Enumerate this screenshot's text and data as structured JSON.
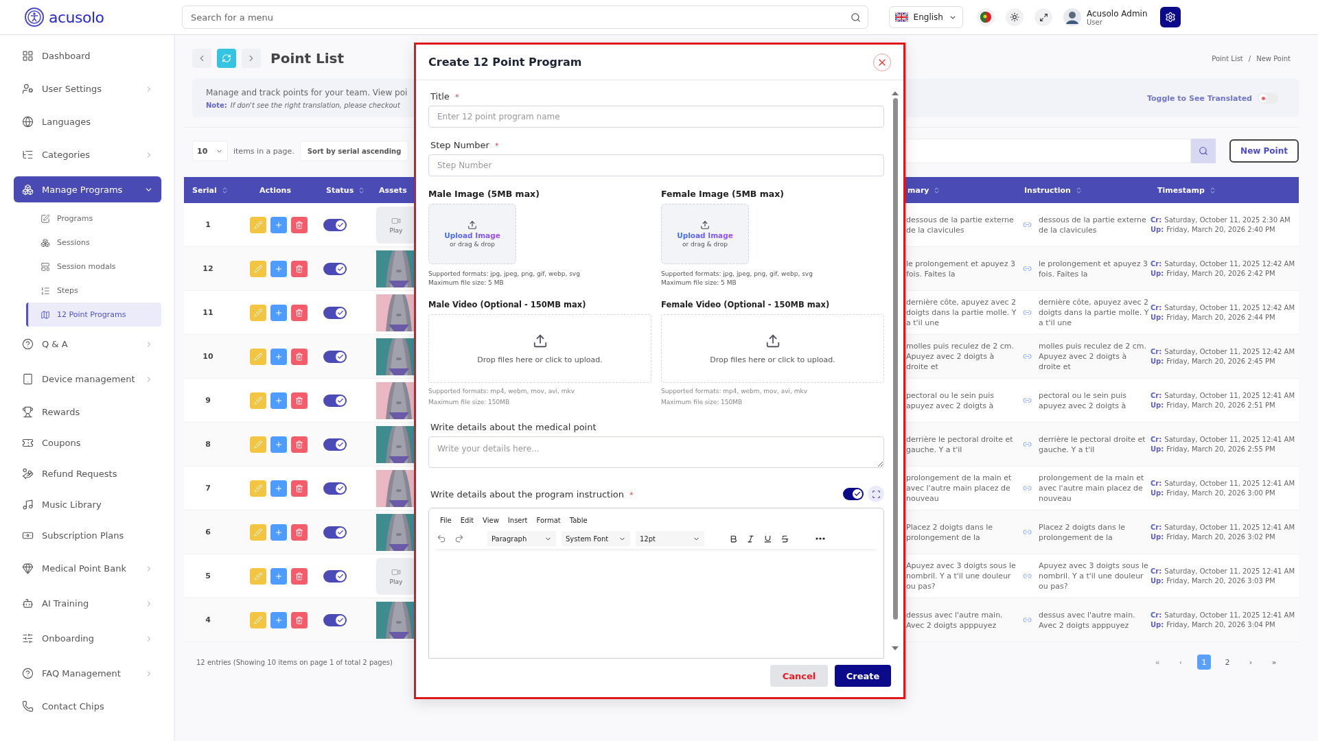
{
  "header": {
    "logo": "acusolo",
    "search_placeholder": "Search for a menu",
    "language": "English",
    "user": {
      "name": "Acusolo Admin",
      "role": "User"
    }
  },
  "sidebar": {
    "items": [
      {
        "label": "Dashboard",
        "selected": false
      },
      {
        "label": "User Settings",
        "selected": false,
        "expanded": false
      },
      {
        "label": "Languages",
        "selected": false
      },
      {
        "label": "Categories",
        "selected": false,
        "expanded": false
      },
      {
        "label": "Manage Programs",
        "selected": true,
        "expanded": true,
        "children": [
          {
            "label": "Programs",
            "selected": false
          },
          {
            "label": "Sessions",
            "selected": false
          },
          {
            "label": "Session modals",
            "selected": false
          },
          {
            "label": "Steps",
            "selected": false
          },
          {
            "label": "12 Point Programs",
            "selected": true
          }
        ]
      },
      {
        "label": "Q & A",
        "selected": false,
        "expanded": false
      },
      {
        "label": "Device management",
        "selected": false,
        "expanded": false
      },
      {
        "label": "Rewards",
        "selected": false
      },
      {
        "label": "Coupons",
        "selected": false
      },
      {
        "label": "Refund Requests",
        "selected": false
      },
      {
        "label": "Music Library",
        "selected": false
      },
      {
        "label": "Subscription Plans",
        "selected": false
      },
      {
        "label": "Medical Point Bank",
        "selected": false,
        "expanded": false
      },
      {
        "label": "AI Training",
        "selected": false,
        "expanded": false
      },
      {
        "label": "Onboarding",
        "selected": false,
        "expanded": false
      },
      {
        "label": "FAQ Management",
        "selected": false,
        "expanded": false
      },
      {
        "label": "Contact Chips",
        "selected": false
      }
    ]
  },
  "page": {
    "title": "Point List",
    "breadcrumb": {
      "items": [
        "Point List",
        "New Point"
      ],
      "separator": "/"
    },
    "description": "Manage and track points for your team. View poi",
    "note_label": "Note:",
    "note": "If don't see the right translation, please checkout",
    "translate_toggle": {
      "label": "Toggle to See Translated",
      "on": false
    },
    "page_size": "10",
    "page_size_label": "items in a page.",
    "sort": "Sort by serial ascending",
    "new_button": "New Point"
  },
  "table": {
    "columns": [
      {
        "label": "Serial",
        "sortable": true
      },
      {
        "label": "Actions",
        "sortable": false
      },
      {
        "label": "Status",
        "sortable": true
      },
      {
        "label": "Assets",
        "sortable": false
      },
      {
        "label": "mary",
        "sortable": true
      },
      {
        "label": "Instruction",
        "sortable": true
      },
      {
        "label": "Timestamp",
        "sortable": true
      }
    ],
    "rows": [
      {
        "serial": "1",
        "on": true,
        "assets": [
          {
            "kind": "video",
            "label": "Play"
          }
        ],
        "summary": "dessous de la partie externe de la clavicules",
        "instruction": "dessous de la partie externe de la clavicules",
        "cr_label": "Cr:",
        "created": "Saturday, October 11, 2025 2:30 AM",
        "up_label": "Up:",
        "updated": "Friday, March 20, 2026 2:40 PM"
      },
      {
        "serial": "12",
        "on": true,
        "summary": "le prolongement et apuyez 3 fois. Faites la",
        "instruction": "le prolongement et apuyez 3 fois. Faites la",
        "cr_label": "Cr:",
        "created": "Saturday, October 11, 2025 12:42 AM",
        "up_label": "Up:",
        "updated": "Friday, March 20, 2026 2:42 PM"
      },
      {
        "serial": "11",
        "on": true,
        "summary": "dernière côte, apuyez avec 2 doigts dans la partie molle. Y a t'il une",
        "instruction": "dernière côte, apuyez avec 2 doigts dans la partie molle. Y a t'il une",
        "cr_label": "Cr:",
        "created": "Saturday, October 11, 2025 12:42 AM",
        "up_label": "Up:",
        "updated": "Friday, March 20, 2026 2:44 PM"
      },
      {
        "serial": "10",
        "on": true,
        "summary": "molles puis reculez de 2 cm. Apuyez avec 2 doigts à droite et",
        "instruction": "molles puis reculez de 2 cm. Apuyez avec 2 doigts à droite et",
        "cr_label": "Cr:",
        "created": "Saturday, October 11, 2025 12:42 AM",
        "up_label": "Up:",
        "updated": "Friday, March 20, 2026 2:45 PM"
      },
      {
        "serial": "9",
        "on": true,
        "summary": "pectoral ou le sein puis apuyez avec 2 doigts à",
        "instruction": "pectoral ou le sein puis apuyez avec 2 doigts à",
        "cr_label": "Cr:",
        "created": "Saturday, October 11, 2025 12:41 AM",
        "up_label": "Up:",
        "updated": "Friday, March 20, 2026 2:51 PM"
      },
      {
        "serial": "8",
        "on": true,
        "summary": "derrière le pectoral droite et gauche. Y a t'il",
        "instruction": "derrière le pectoral droite et gauche. Y a t'il",
        "cr_label": "Cr:",
        "created": "Saturday, October 11, 2025 12:41 AM",
        "up_label": "Up:",
        "updated": "Friday, March 20, 2026 2:55 PM"
      },
      {
        "serial": "7",
        "on": true,
        "summary": "prolongement de la main et avec l'autre main placez de nouveau",
        "instruction": "prolongement de la main et avec l'autre main placez de nouveau",
        "cr_label": "Cr:",
        "created": "Saturday, October 11, 2025 12:41 AM",
        "up_label": "Up:",
        "updated": "Friday, March 20, 2026 3:00 PM"
      },
      {
        "serial": "6",
        "on": true,
        "summary": "Placez 2 doigts dans le prolongement de la",
        "instruction": "Placez 2 doigts dans le prolongement de la",
        "cr_label": "Cr:",
        "created": "Saturday, October 11, 2025 12:41 AM",
        "up_label": "Up:",
        "updated": "Friday, March 20, 2026 3:02 PM"
      },
      {
        "serial": "5",
        "on": true,
        "assets": [
          {
            "kind": "video",
            "label": "Play"
          }
        ],
        "summary": "Apuyez avec 3 doigts sous le nombril. Y a t'il une douleur ou pas?",
        "instruction": "Apuyez avec 3 doigts sous le nombril. Y a t'il une douleur ou pas?",
        "cr_label": "Cr:",
        "created": "Saturday, October 11, 2025 12:41 AM",
        "up_label": "Up:",
        "updated": "Friday, March 20, 2026 3:03 PM"
      },
      {
        "serial": "4",
        "on": true,
        "summary": "dessus avec l'autre main. Avec 2 doigts apppuyez",
        "instruction": "dessus avec l'autre main. Avec 2 doigts apppuyez",
        "cr_label": "Cr:",
        "created": "Saturday, October 11, 2025 12:41 AM",
        "up_label": "Up:",
        "updated": "Friday, March 20, 2026 3:04 PM"
      }
    ],
    "footer": "12 entries (Showing 10 items on page 1 of total 2 pages)"
  },
  "pagination": {
    "first": "«",
    "prev": "‹",
    "pages": [
      {
        "label": "1",
        "selected": true
      },
      {
        "label": "2",
        "selected": false
      }
    ],
    "next": "›",
    "last": "»"
  },
  "modal": {
    "title": "Create 12 Point Program",
    "fields": [
      {
        "label": "Title",
        "mark": "*",
        "placeholder": "Enter 12 point program name"
      },
      {
        "label": "Step Number",
        "mark": "*",
        "placeholder": "Step Number"
      }
    ],
    "image_uploads": [
      {
        "label": "Male Image (5MB max)",
        "action": "Upload Image",
        "hint": "or drag & drop",
        "formats": "Supported formats: jpg, jpeg, png, gif, webp, svg",
        "max_size": "Maximum file size: 5 MB"
      },
      {
        "label": "Female Image (5MB max)",
        "action": "Upload Image",
        "hint": "or drag & drop",
        "formats": "Supported formats: jpg, jpeg, png, gif, webp, svg",
        "max_size": "Maximum file size: 5 MB"
      }
    ],
    "video_uploads": [
      {
        "label": "Male Video (Optional - 150MB max)",
        "prompt": "Drop files here or click to upload.",
        "formats": "Supported formats: mp4, webm, mov, avi, mkv",
        "max_size": "Maximum file size: 150MB"
      },
      {
        "label": "Female Video (Optional - 150MB max)",
        "prompt": "Drop files here or click to upload.",
        "formats": "Supported formats: mp4, webm, mov, avi, mkv",
        "max_size": "Maximum file size: 150MB"
      }
    ],
    "details": {
      "label": "Write details about the medical point",
      "placeholder": "Write your details here..."
    },
    "instruction": {
      "label": "Write details about the program instruction",
      "mark": "*",
      "toggle_on": true,
      "menus": [
        "File",
        "Edit",
        "View",
        "Insert",
        "Format",
        "Table"
      ],
      "block_format": "Paragraph",
      "font": "System Font",
      "size": "12pt"
    },
    "buttons": {
      "cancel": "Cancel",
      "create": "Create"
    }
  }
}
